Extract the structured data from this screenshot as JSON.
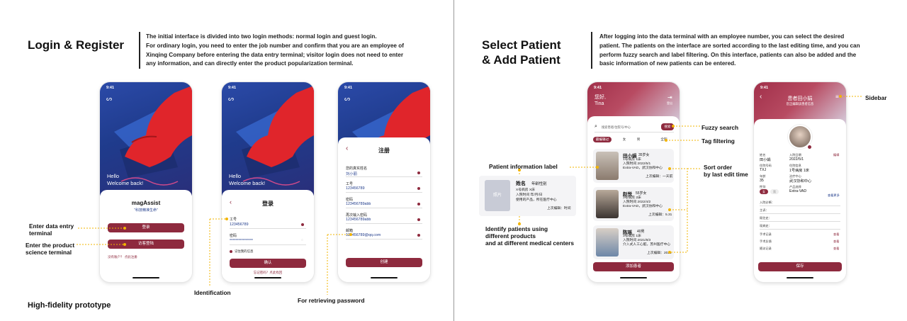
{
  "left": {
    "title": "Login & Register",
    "desc_lines": [
      "The initial interface is divided into two login methods: normal login and guest login.",
      "For ordinary login, you need to enter the job number and confirm that you are an employee of",
      "Xinqing Company before entering the data entry terminal; visitor login does not need to enter",
      "any information, and can directly enter the product popularization terminal."
    ],
    "caption": "High-fidelity prototype",
    "ann_entry": [
      "Enter data entry",
      "terminal"
    ],
    "ann_science": [
      "Enter the product",
      "science terminal"
    ],
    "ann_identification": "Identification",
    "ann_password": "For retrieving password"
  },
  "right": {
    "title_1": "Select Patient",
    "title_2": "& Add Patient",
    "desc_lines": [
      "After logging into the data terminal with an employee number, you can select the desired",
      "patient. The patients on the interface are sorted according to the last editing time, and you can",
      "perform fuzzy search and label filtering. On this interface, patients can also be added and the",
      "basic information of new patients can be entered."
    ],
    "ann_fuzzy": "Fuzzy search",
    "ann_tag": "Tag filtering",
    "ann_sort": [
      "Sort order",
      "by last edit time"
    ],
    "ann_sidebar": "Sidebar",
    "ann_patient_label": "Patient information label",
    "ann_identify": [
      "Identify patients using",
      "different products",
      "and at different medical centers"
    ]
  },
  "phone1": {
    "time": "9:41",
    "hello": "Hello",
    "welcome": "Welcome back!",
    "app_name": "magAssist",
    "slogan": "“科技精准生命”",
    "btn_login": "登录",
    "btn_guest": "访客登陆",
    "register_link": "没有账户？ 点此注册"
  },
  "phone2": {
    "time": "9:41",
    "hello": "Hello",
    "welcome": "Welcome back!",
    "title": "登录",
    "job_label": "工号",
    "job_value": "123456789",
    "pwd_label": "密码",
    "pwd_value": "****************",
    "remember": "记住我的信息",
    "confirm": "确认",
    "forgot": "忘记密码？点此找回"
  },
  "phone3": {
    "time": "9:41",
    "title": "注册",
    "fields": [
      {
        "label": "您的真实姓名",
        "value": "刘小丽"
      },
      {
        "label": "工号",
        "value": "123456789"
      },
      {
        "label": "密码",
        "value": "123456789abb"
      },
      {
        "label": "再次输入密码",
        "value": "123456789abb"
      },
      {
        "label": "邮箱",
        "value": "123456789@qq.com"
      }
    ],
    "create": "创建"
  },
  "phone4": {
    "time": "9:41",
    "greeting": "您好,",
    "name": "Tina",
    "logout": "登出",
    "search_placeholder": "搜索患者/住院号/中心",
    "search_btn": "搜索",
    "tags": [
      "最编辑过",
      "女",
      "男",
      "全院"
    ],
    "patients": [
      {
        "name": "田小娟",
        "meta": "35岁女",
        "l1": "1号病房 1床",
        "l2": "入院时间 2022/5/1",
        "l3": "Extra-VAD，武汉协和中心",
        "l4": "上次编辑：一天前"
      },
      {
        "name": "赵悦",
        "meta": "55岁女",
        "l1": "3号病房 2床",
        "l2": "入院时间 2022/4/2",
        "l3": "Extra-VAD，武汉协和中心",
        "l4": "上次编辑：5.31"
      },
      {
        "name": "陈瑶",
        "meta": "40男",
        "l1": "3号病房 1床",
        "l2": "入院时间 2021/8/3",
        "l3": "介入式人工心脏，苏州医疗中心",
        "l4": "上次编辑：2021"
      }
    ],
    "add_btn": "添加患者"
  },
  "label_card": {
    "photo": "照片",
    "name_line": "姓名",
    "meta": "年龄性别",
    "l1": "X号病房 X床",
    "l2": "入院时间 年/月/日",
    "l3": "使用的产品，所在医疗中心",
    "l4": "上次编辑：时间"
  },
  "phone5": {
    "time": "9:41",
    "title": "患者田小娟",
    "subtitle": "您正编辑该患者信息",
    "rows": [
      {
        "k1": "姓名",
        "v1": "田小娟",
        "k2": "入院日期",
        "v2": "2022/5/1",
        "edit": "编辑"
      },
      {
        "k1": "住院号码",
        "v1": "TXJ",
        "k2": "住院信息",
        "v2": "1号病房 1床"
      },
      {
        "k1": "年龄",
        "v1": "35",
        "k2": "治疗中心",
        "v2": "武汉协和中心"
      },
      {
        "k1": "性别",
        "v1": "",
        "k2": "产品选择",
        "v2": "Extra-VAD"
      }
    ],
    "gender_f": "女",
    "gender_m": "男",
    "more": "查看更多",
    "sections": [
      "入院诊断：",
      "主诉：",
      "既往史：",
      "现病史："
    ],
    "records": [
      "手术记录",
      "手术反馈",
      "随访记录"
    ],
    "view": "查看",
    "save": "保存"
  },
  "colors": {
    "accent": "#8e2a3e",
    "annotation": "#f2b400",
    "hero_blue": "#2b4aa8"
  }
}
